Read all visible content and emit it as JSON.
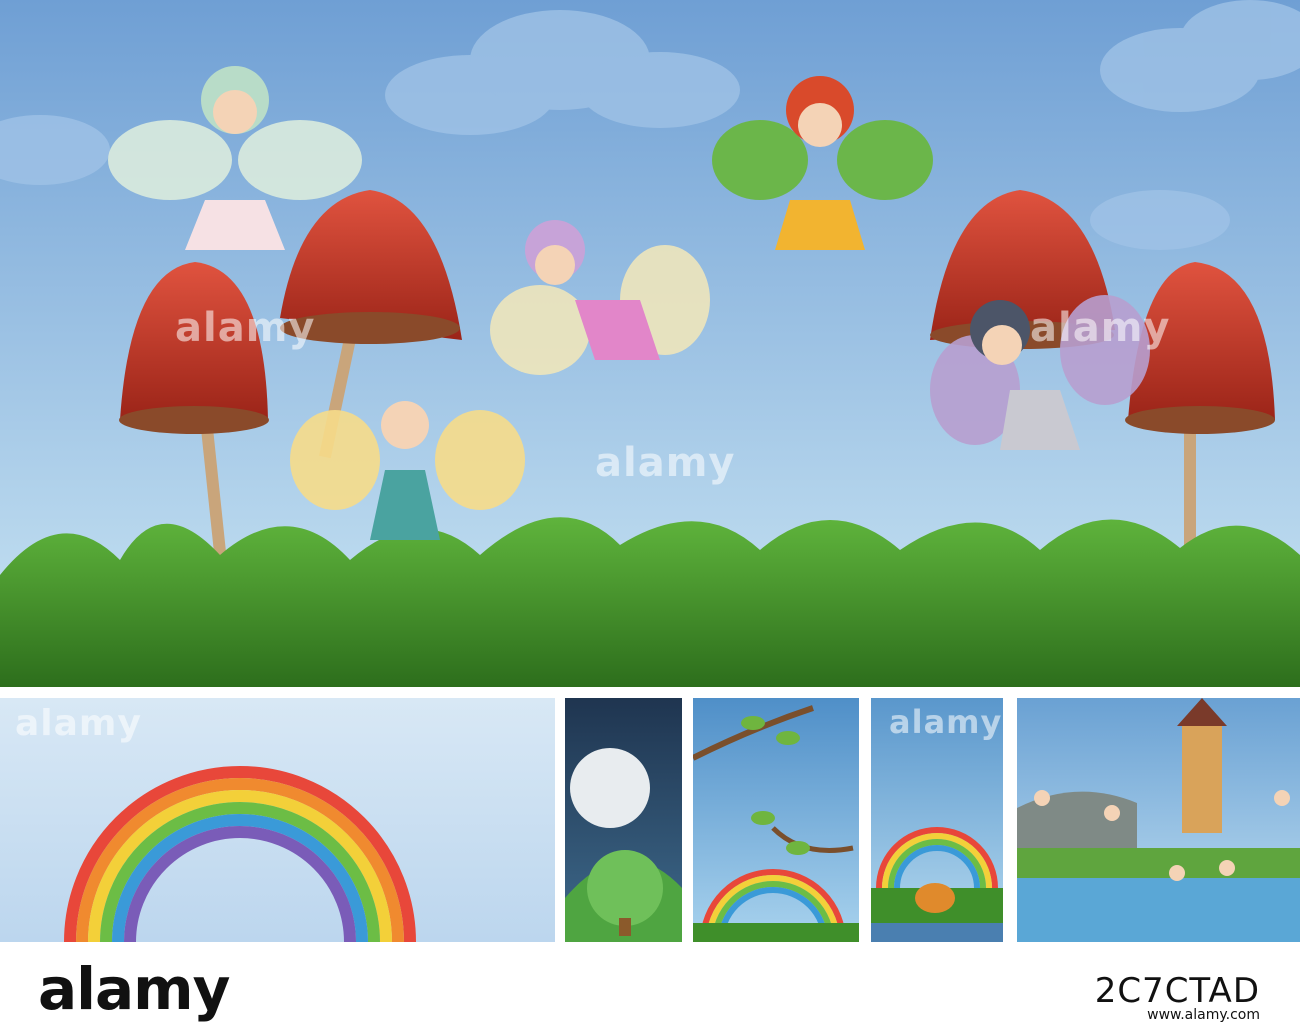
{
  "watermark": "alamy",
  "footer": {
    "logo": "alamy",
    "image_id": "2C7CTAD",
    "url": "www.alamy.com"
  },
  "colors": {
    "sky_top": "#6f9fd4",
    "sky_bottom": "#c7e3f3",
    "grass": "#3f8f2a",
    "mushroom_red": "#c8382c"
  },
  "scenes": [
    {
      "name": "fairies-in-mushroom-meadow"
    },
    {
      "name": "rainbow-sky"
    },
    {
      "name": "night-moon-hill-house"
    },
    {
      "name": "tree-branches-rainbow"
    },
    {
      "name": "rainbow-pumpkin-house"
    },
    {
      "name": "fairy-castle-lake"
    }
  ]
}
